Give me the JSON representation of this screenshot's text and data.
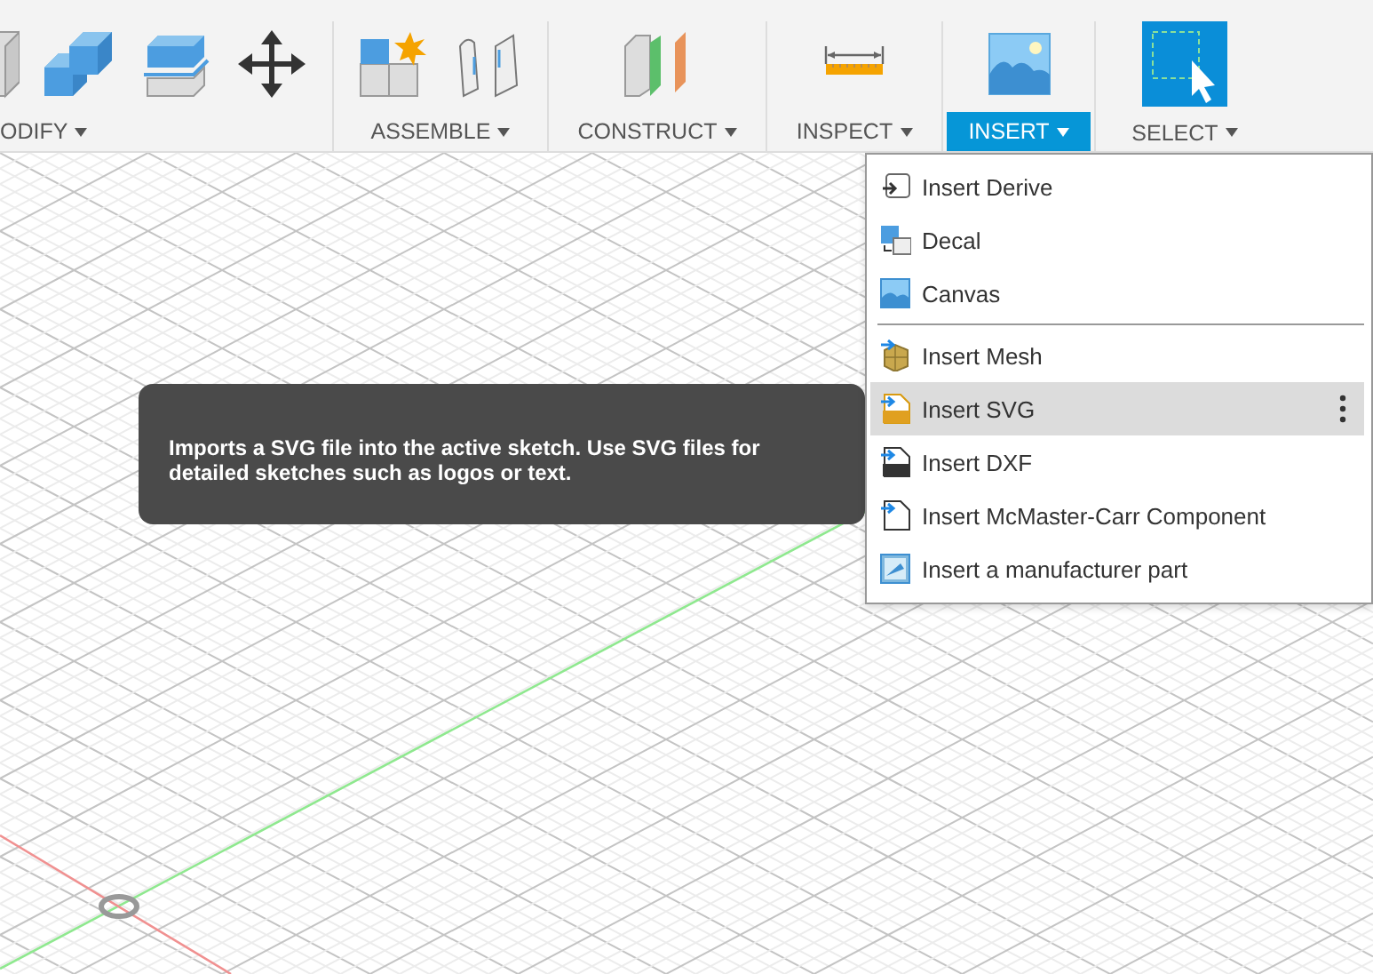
{
  "toolbar": {
    "groups": [
      {
        "kind": "modify",
        "label": "ODIFY",
        "selected": false
      },
      {
        "kind": "assemble",
        "label": "ASSEMBLE",
        "selected": false
      },
      {
        "kind": "construct",
        "label": "CONSTRUCT",
        "selected": false
      },
      {
        "kind": "inspect",
        "label": "INSPECT",
        "selected": false
      },
      {
        "kind": "insert",
        "label": "INSERT",
        "selected": true
      },
      {
        "kind": "select",
        "label": "SELECT",
        "selected": false
      }
    ]
  },
  "tooltip": {
    "text": "Imports a SVG file into the active sketch. Use SVG files for detailed sketches such as logos or text."
  },
  "menu": {
    "sections": [
      [
        {
          "kind": "derive",
          "label": "Insert Derive",
          "selected": false
        },
        {
          "kind": "decal",
          "label": "Decal",
          "selected": false
        },
        {
          "kind": "canvas",
          "label": "Canvas",
          "selected": false
        }
      ],
      [
        {
          "kind": "mesh",
          "label": "Insert Mesh",
          "selected": false
        },
        {
          "kind": "svg",
          "label": "Insert SVG",
          "selected": true
        },
        {
          "kind": "dxf",
          "label": "Insert DXF",
          "selected": false
        },
        {
          "kind": "mcmaster",
          "label": "Insert McMaster-Carr Component",
          "selected": false
        },
        {
          "kind": "part",
          "label": "Insert a manufacturer part",
          "selected": false
        }
      ]
    ]
  }
}
